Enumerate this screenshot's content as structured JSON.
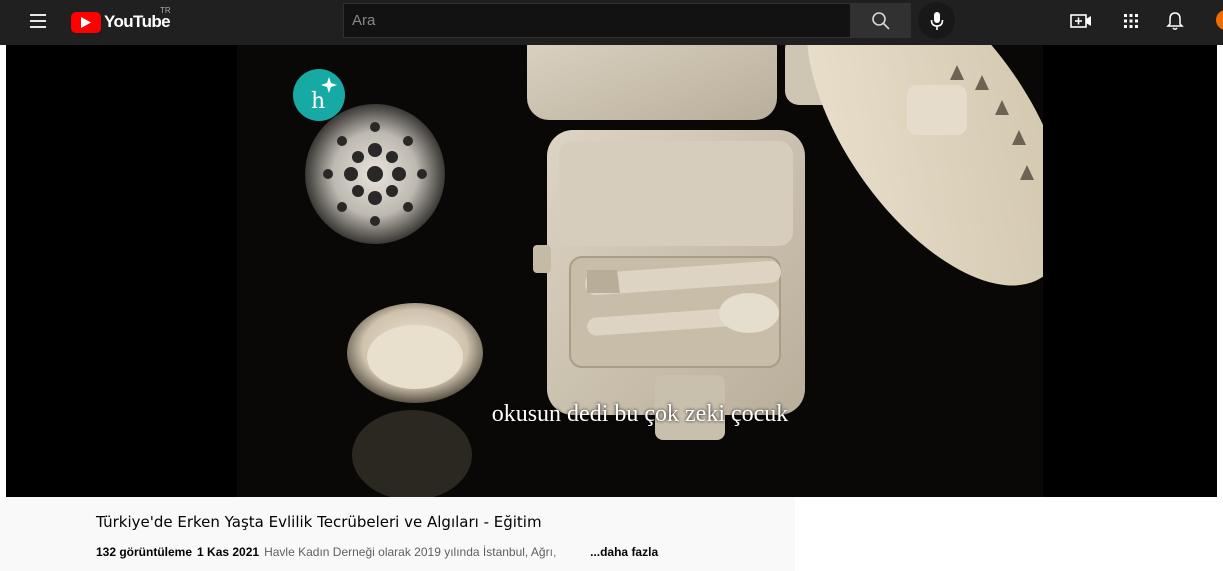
{
  "header": {
    "logo_text": "YouTube",
    "country_code": "TR",
    "search_placeholder": "Ara",
    "icons": [
      "menu-icon",
      "search-icon",
      "mic-icon",
      "create-video-icon",
      "apps-grid-icon",
      "bell-icon"
    ]
  },
  "player": {
    "subtitle": "okusun dedi bu çok zeki çocuk",
    "channel_watermark": "h"
  },
  "video": {
    "title": "Türkiye'de Erken Yaşta Evlilik Tecrübeleri ve Algıları - Eğitim",
    "views": "132 görüntüleme",
    "date": "1 Kas 2021",
    "description_snippet": "Havle Kadın Derneği olarak 2019 yılında İstanbul, Ağrı,",
    "more_label": "...daha fazla"
  },
  "colors": {
    "topbar": "#202020",
    "brand_red": "#ff0000",
    "watermark_teal": "#17aaa5"
  }
}
